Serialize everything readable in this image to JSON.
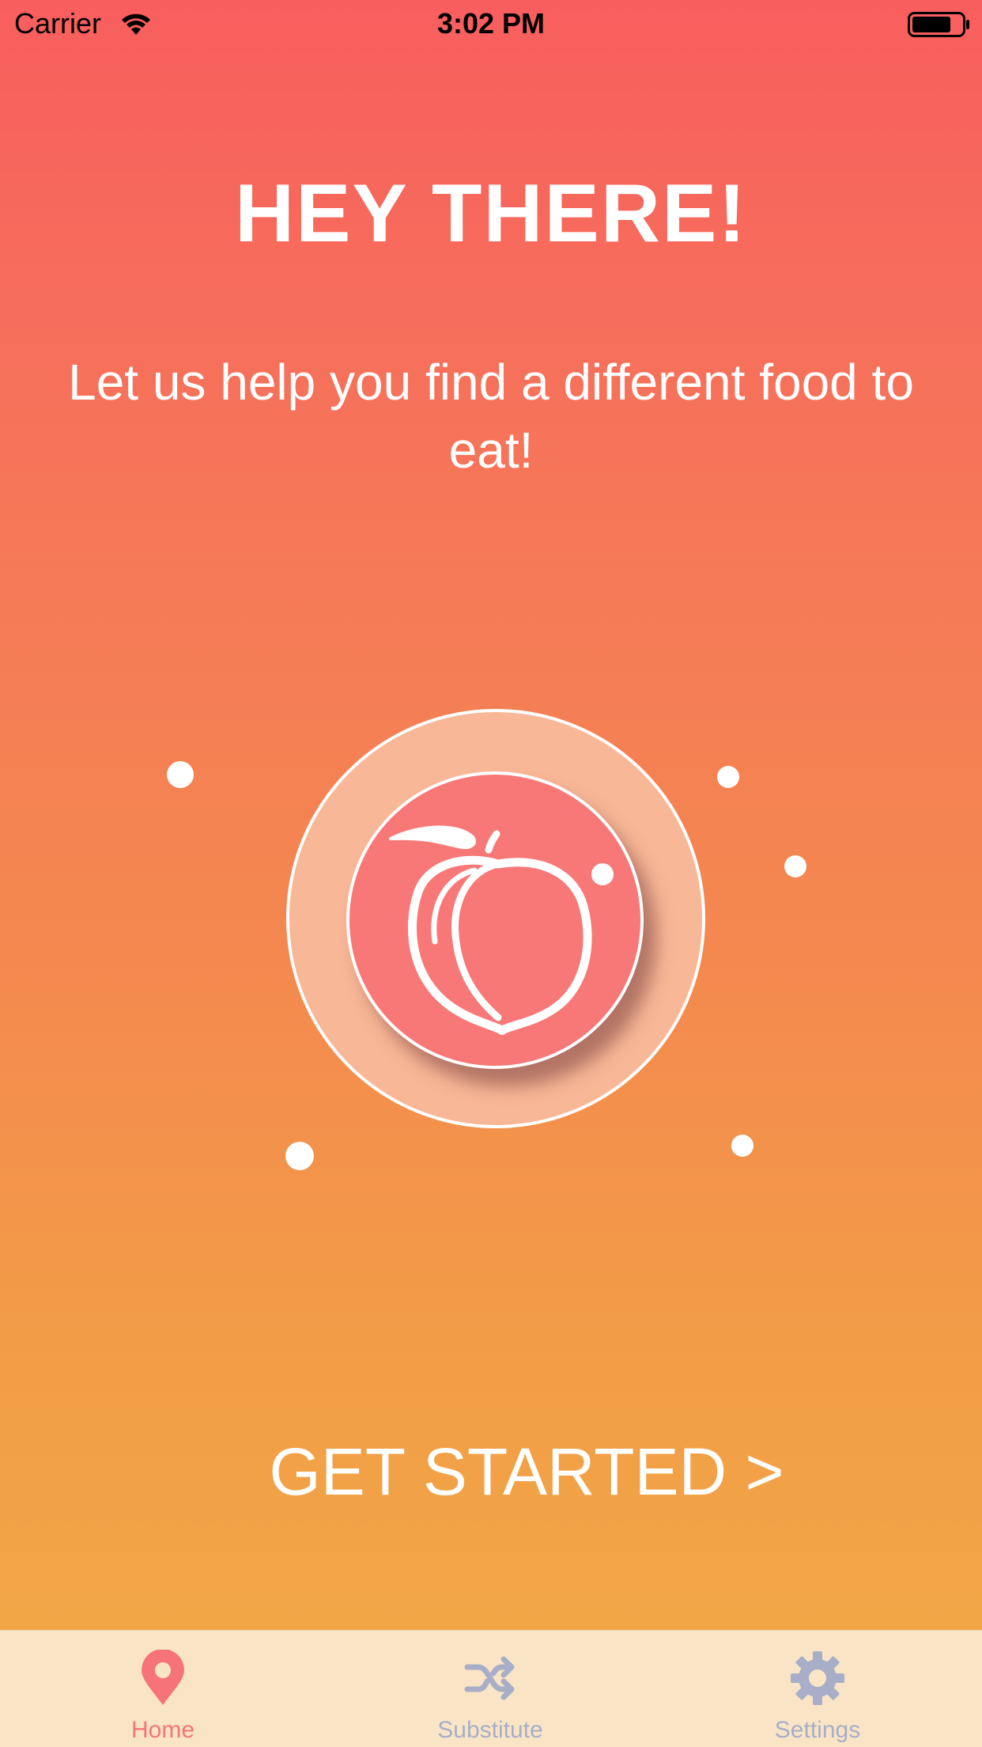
{
  "status_bar": {
    "carrier": "Carrier",
    "time": "3:02 PM",
    "wifi_icon": "wifi-icon",
    "battery_icon": "battery-icon"
  },
  "main": {
    "title": "HEY THERE!",
    "subtitle": "Let us help you find a different food to eat!",
    "emblem_icon": "peach-icon",
    "get_started_label": "GET STARTED  >"
  },
  "tab_bar": {
    "tabs": [
      {
        "label": "Home",
        "icon": "map-pin-icon",
        "selected": true
      },
      {
        "label": "Substitute",
        "icon": "shuffle-icon",
        "selected": false
      },
      {
        "label": "Settings",
        "icon": "gear-icon",
        "selected": false
      }
    ]
  },
  "colors": {
    "gradient_top": "#f85e5e",
    "gradient_bottom": "#f2a945",
    "active_tab": "#f6737a",
    "inactive_tab": "#a8aec8",
    "tab_bar_bg": "#f9e5c5",
    "inner_circle": "#f87878",
    "outer_ring": "#f8b796"
  }
}
